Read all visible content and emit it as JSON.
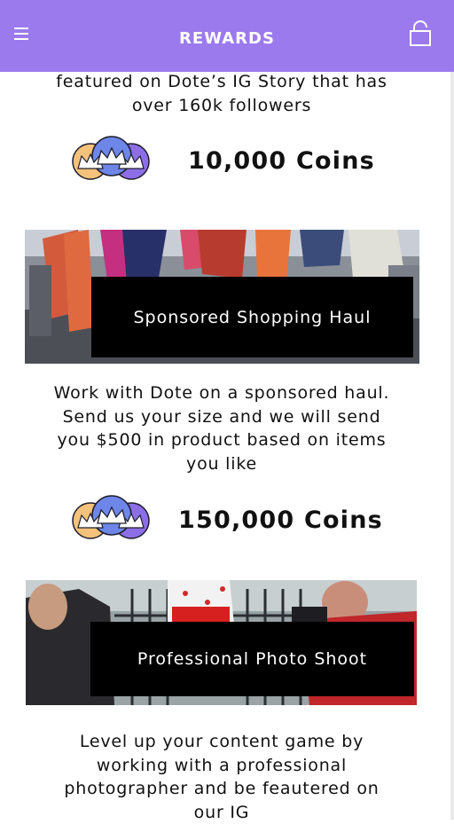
{
  "header": {
    "title": "REWARDS",
    "menu_icon": "hamburger-menu-icon",
    "lock_icon": "lock-icon",
    "background": "#9b7aed"
  },
  "rewards": [
    {
      "description_lines": [
        "featured on Dote’s IG Story that has",
        "over 160k followers"
      ],
      "coins": "10,000 Coins"
    },
    {
      "title": "Sponsored Shopping Haul",
      "description_lines": [
        "Work with Dote on a sponsored haul.",
        "Send us your size and we will send",
        "you $500 in product based on items",
        "you like"
      ],
      "coins": "150,000 Coins"
    },
    {
      "title": "Professional Photo Shoot",
      "description_lines": [
        "Level up your content game by",
        "working with a professional",
        "photographer and be feautered on",
        "our IG"
      ]
    }
  ],
  "coin_icon": "crown-coins-icon",
  "colors": {
    "accent": "#9b7aed",
    "coin_gold": "#f4c27a",
    "coin_blue": "#6e86e8",
    "coin_purple": "#8c6ee6"
  }
}
